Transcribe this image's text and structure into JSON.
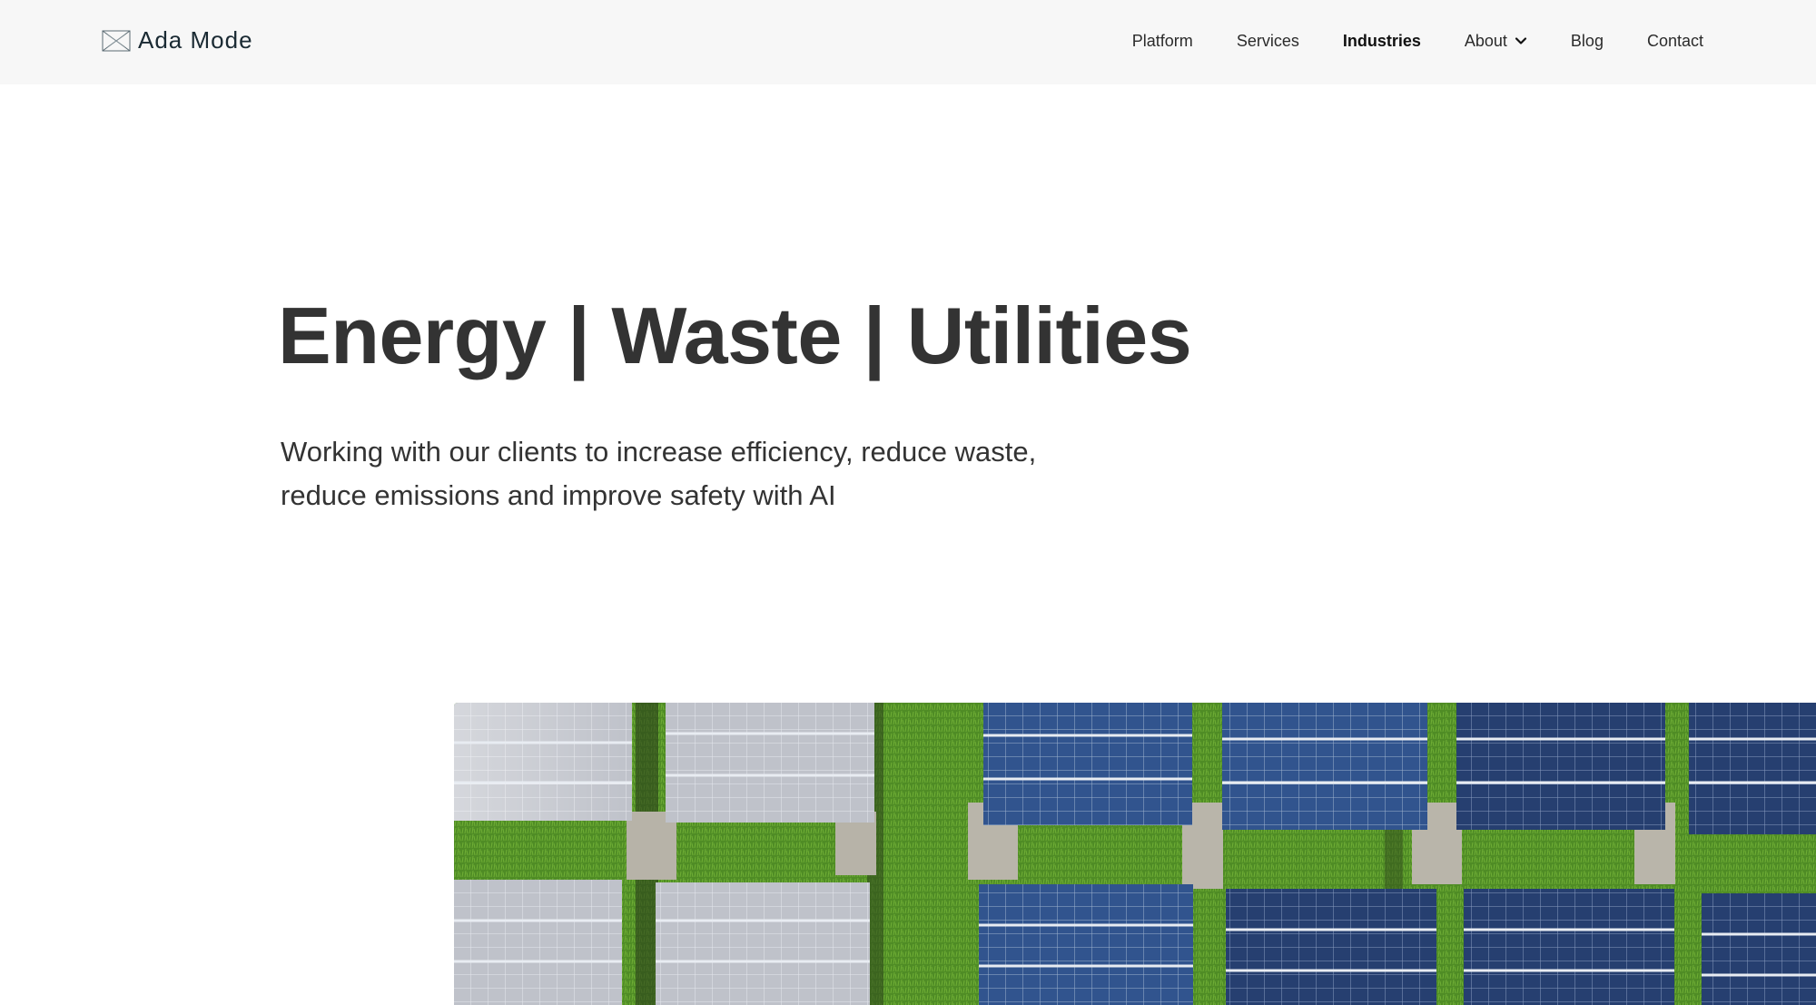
{
  "brand": {
    "name": "Ada Mode"
  },
  "nav": {
    "items": [
      {
        "label": "Platform"
      },
      {
        "label": "Services"
      },
      {
        "label": "Industries",
        "active": true
      },
      {
        "label": "About",
        "has_dropdown": true
      },
      {
        "label": "Blog"
      },
      {
        "label": "Contact"
      }
    ]
  },
  "hero": {
    "title": "Energy | Waste | Utilities",
    "subtitle_line1": "Working with our clients to increase efficiency, reduce waste,",
    "subtitle_line2": "reduce emissions and improve safety with AI"
  },
  "colors": {
    "header_bg": "#f7f7f7",
    "text": "#333333",
    "grass": "#4f8c25",
    "panel_blue": "#2f4f86",
    "panel_silver": "#b9bcc4"
  },
  "icons": {
    "logo": "ada-mode-logo-icon",
    "about_dropdown": "chevron-down-icon"
  }
}
